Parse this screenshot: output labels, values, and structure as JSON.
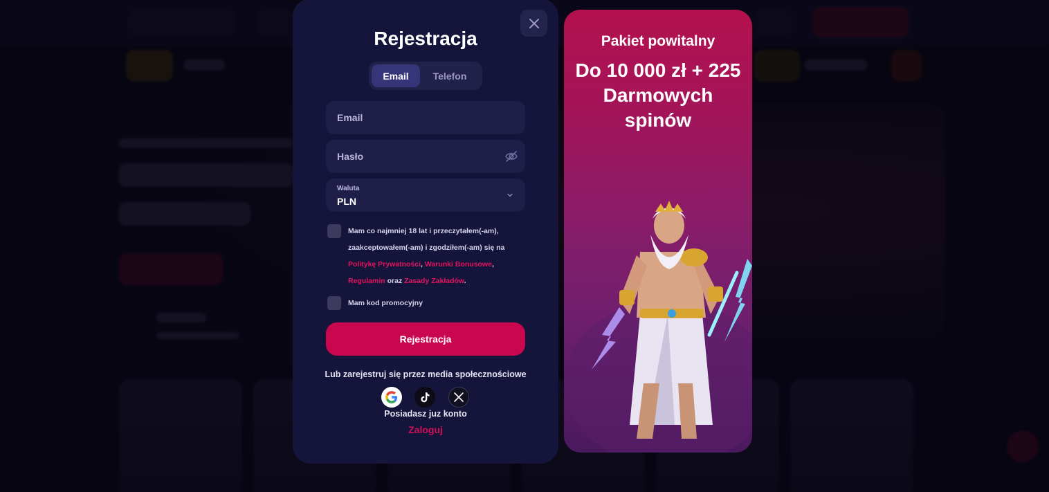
{
  "modal": {
    "title": "Rejestracja",
    "tabs": [
      {
        "label": "Email",
        "active": true
      },
      {
        "label": "Telefon",
        "active": false
      }
    ],
    "email_placeholder": "Email",
    "password_placeholder": "Hasło",
    "currency": {
      "label": "Waluta",
      "value": "PLN"
    },
    "consent": {
      "text_1": "Mam co najmniej 18 lat i przeczytałem(-am), zaakceptowałem(-am) i zgodziłem(-am) się na",
      "privacy_link": "Politykę Prywatności",
      "sep_1": ",",
      "bonus_link": "Warunki Bonusowe",
      "sep_2": ",",
      "terms_link": "Regulamin",
      "and": "oraz",
      "betting_link": "Zasady Zakładów",
      "end": "."
    },
    "promo_code_label": "Mam kod promocyjny",
    "submit_label": "Rejestracja",
    "social_text": "Lub zarejestruj się przez media społecznościowe",
    "social": [
      "google-icon",
      "tiktok-icon",
      "x-icon"
    ],
    "account_text": "Posiadasz juz konto",
    "login_label": "Zaloguj"
  },
  "promo": {
    "subtitle": "Pakiet powitalny",
    "headline": "Do 10 000 zł + 225 Darmowych spinów"
  },
  "colors": {
    "modal_bg": "#15143a",
    "field_bg": "#1f1e48",
    "accent": "#c9074f",
    "link": "#e0155f"
  }
}
